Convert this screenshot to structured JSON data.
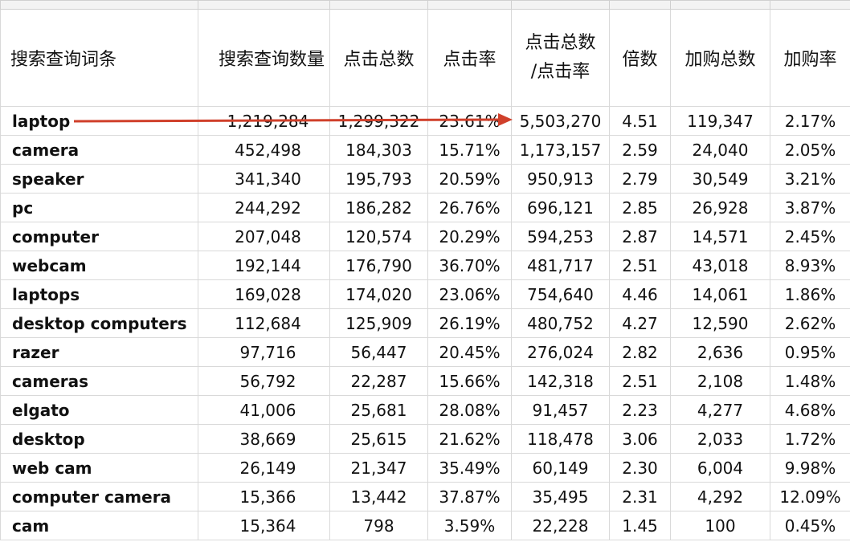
{
  "headers": {
    "term": "搜索查询词条",
    "search_volume": "搜索查询数量",
    "total_clicks": "点击总数",
    "ctr": "点击率",
    "clicks_over_ctr_line1": "点击总数",
    "clicks_over_ctr_line2": "/点击率",
    "multiple": "倍数",
    "total_add_to_cart": "加购总数",
    "add_to_cart_rate": "加购率"
  },
  "rows": [
    {
      "term": "laptop",
      "search_volume": "1,219,284",
      "total_clicks": "1,299,322",
      "ctr": "23.61%",
      "clicks_over_ctr": "5,503,270",
      "multiple": "4.51",
      "total_add_to_cart": "119,347",
      "add_to_cart_rate": "2.17%"
    },
    {
      "term": "camera",
      "search_volume": "452,498",
      "total_clicks": "184,303",
      "ctr": "15.71%",
      "clicks_over_ctr": "1,173,157",
      "multiple": "2.59",
      "total_add_to_cart": "24,040",
      "add_to_cart_rate": "2.05%"
    },
    {
      "term": "speaker",
      "search_volume": "341,340",
      "total_clicks": "195,793",
      "ctr": "20.59%",
      "clicks_over_ctr": "950,913",
      "multiple": "2.79",
      "total_add_to_cart": "30,549",
      "add_to_cart_rate": "3.21%"
    },
    {
      "term": "pc",
      "search_volume": "244,292",
      "total_clicks": "186,282",
      "ctr": "26.76%",
      "clicks_over_ctr": "696,121",
      "multiple": "2.85",
      "total_add_to_cart": "26,928",
      "add_to_cart_rate": "3.87%"
    },
    {
      "term": "computer",
      "search_volume": "207,048",
      "total_clicks": "120,574",
      "ctr": "20.29%",
      "clicks_over_ctr": "594,253",
      "multiple": "2.87",
      "total_add_to_cart": "14,571",
      "add_to_cart_rate": "2.45%"
    },
    {
      "term": "webcam",
      "search_volume": "192,144",
      "total_clicks": "176,790",
      "ctr": "36.70%",
      "clicks_over_ctr": "481,717",
      "multiple": "2.51",
      "total_add_to_cart": "43,018",
      "add_to_cart_rate": "8.93%"
    },
    {
      "term": "laptops",
      "search_volume": "169,028",
      "total_clicks": "174,020",
      "ctr": "23.06%",
      "clicks_over_ctr": "754,640",
      "multiple": "4.46",
      "total_add_to_cart": "14,061",
      "add_to_cart_rate": "1.86%"
    },
    {
      "term": "desktop computers",
      "search_volume": "112,684",
      "total_clicks": "125,909",
      "ctr": "26.19%",
      "clicks_over_ctr": "480,752",
      "multiple": "4.27",
      "total_add_to_cart": "12,590",
      "add_to_cart_rate": "2.62%"
    },
    {
      "term": "razer",
      "search_volume": "97,716",
      "total_clicks": "56,447",
      "ctr": "20.45%",
      "clicks_over_ctr": "276,024",
      "multiple": "2.82",
      "total_add_to_cart": "2,636",
      "add_to_cart_rate": "0.95%"
    },
    {
      "term": "cameras",
      "search_volume": "56,792",
      "total_clicks": "22,287",
      "ctr": "15.66%",
      "clicks_over_ctr": "142,318",
      "multiple": "2.51",
      "total_add_to_cart": "2,108",
      "add_to_cart_rate": "1.48%"
    },
    {
      "term": "elgato",
      "search_volume": "41,006",
      "total_clicks": "25,681",
      "ctr": "28.08%",
      "clicks_over_ctr": "91,457",
      "multiple": "2.23",
      "total_add_to_cart": "4,277",
      "add_to_cart_rate": "4.68%"
    },
    {
      "term": "desktop",
      "search_volume": "38,669",
      "total_clicks": "25,615",
      "ctr": "21.62%",
      "clicks_over_ctr": "118,478",
      "multiple": "3.06",
      "total_add_to_cart": "2,033",
      "add_to_cart_rate": "1.72%"
    },
    {
      "term": "web cam",
      "search_volume": "26,149",
      "total_clicks": "21,347",
      "ctr": "35.49%",
      "clicks_over_ctr": "60,149",
      "multiple": "2.30",
      "total_add_to_cart": "6,004",
      "add_to_cart_rate": "9.98%"
    },
    {
      "term": "computer camera",
      "search_volume": "15,366",
      "total_clicks": "13,442",
      "ctr": "37.87%",
      "clicks_over_ctr": "35,495",
      "multiple": "2.31",
      "total_add_to_cart": "4,292",
      "add_to_cart_rate": "12.09%"
    },
    {
      "term": "cam",
      "search_volume": "15,364",
      "total_clicks": "798",
      "ctr": "3.59%",
      "clicks_over_ctr": "22,228",
      "multiple": "1.45",
      "total_add_to_cart": "100",
      "add_to_cart_rate": "0.45%"
    }
  ],
  "annotation": {
    "arrow_color": "#d0402b",
    "arrow_icon": "red-arrow-annotation"
  },
  "colors": {
    "grid": "#d9d9d9",
    "text": "#111111"
  }
}
